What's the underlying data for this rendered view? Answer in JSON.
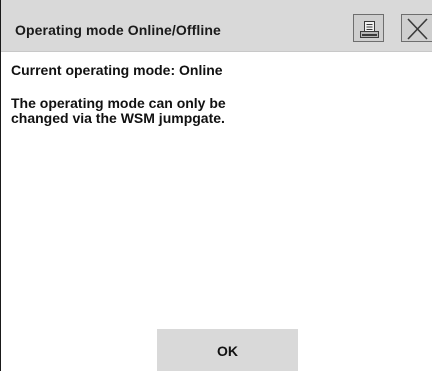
{
  "dialog": {
    "title": "Operating mode Online/Offline",
    "icons": {
      "print": "printer-icon",
      "close": "close-icon"
    }
  },
  "content": {
    "current_mode_line": "Current operating mode: Online",
    "info_text": "The operating mode can only be\nchanged via the WSM jumpgate."
  },
  "footer": {
    "ok_label": "OK"
  }
}
